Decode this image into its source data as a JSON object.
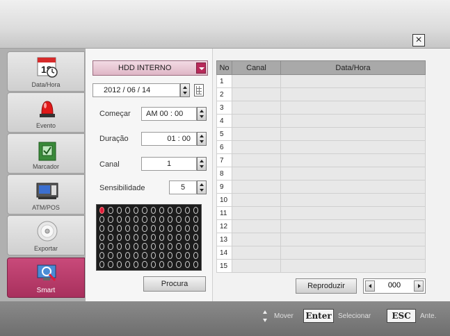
{
  "header": {
    "close_label": "×"
  },
  "sidebar": {
    "items": [
      {
        "label": "Data/Hora",
        "icon": "calendar-clock-icon",
        "date_num": "18",
        "active": false
      },
      {
        "label": "Evento",
        "icon": "alarm-light-icon",
        "active": false
      },
      {
        "label": "Marcador",
        "icon": "checkbox-marker-icon",
        "active": false
      },
      {
        "label": "ATM/POS",
        "icon": "atm-pos-icon",
        "active": false
      },
      {
        "label": "Exportar",
        "icon": "disc-export-icon",
        "active": false
      },
      {
        "label": "Smart",
        "icon": "smart-search-icon",
        "active": true
      }
    ]
  },
  "search": {
    "storage": "HDD INTERNO",
    "date": "2012  /  06  /  14",
    "start_label": "Começar",
    "start_value": "AM  00 : 00",
    "duration_label": "Duração",
    "duration_value": "01 : 00",
    "channel_label": "Canal",
    "channel_value": "1",
    "sensitivity_label": "Sensibilidade",
    "sensitivity_value": "5",
    "search_button": "Procura"
  },
  "results": {
    "col_no": "No",
    "col_channel": "Canal",
    "col_datetime": "Data/Hora",
    "rows": [
      "1",
      "2",
      "3",
      "4",
      "5",
      "6",
      "7",
      "8",
      "9",
      "10",
      "11",
      "12",
      "13",
      "14",
      "15"
    ],
    "play_button": "Reproduzir",
    "page_value": "000"
  },
  "footer": {
    "move_label": "Mover",
    "enter_key": "Enter",
    "select_label": "Selecionar",
    "esc_key": "ESC",
    "back_label": "Ante."
  },
  "colors": {
    "accent": "#b82a5a",
    "active_tab": "#c94a7a"
  }
}
